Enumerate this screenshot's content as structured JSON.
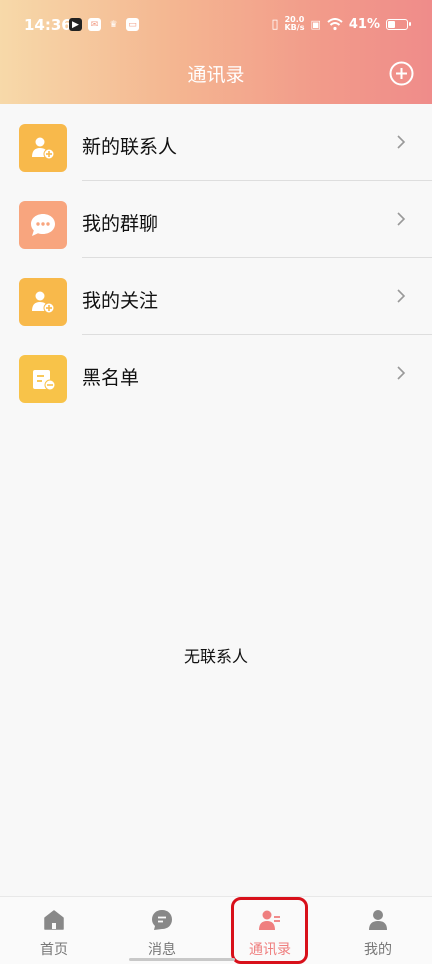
{
  "status_bar": {
    "time": "14:36",
    "net_speed_value": "20.0",
    "net_speed_unit": "KB/s",
    "battery": "41%",
    "battery_level": 0.41
  },
  "header": {
    "title": "通讯录",
    "add_icon": "plus-circle-icon"
  },
  "menu": [
    {
      "label": "新的联系人",
      "icon": "person-add-icon",
      "icon_bg": "#f8b94b"
    },
    {
      "label": "我的群聊",
      "icon": "chat-bubble-icon",
      "icon_bg": "#f8a57e"
    },
    {
      "label": "我的关注",
      "icon": "person-add-icon",
      "icon_bg": "#f8b94b"
    },
    {
      "label": "黑名单",
      "icon": "blacklist-icon",
      "icon_bg": "#f8c349"
    }
  ],
  "empty_text": "无联系人",
  "tabs": [
    {
      "label": "首页",
      "icon": "home-icon",
      "active": false
    },
    {
      "label": "消息",
      "icon": "message-icon",
      "active": false
    },
    {
      "label": "通讯录",
      "icon": "contacts-icon",
      "active": true
    },
    {
      "label": "我的",
      "icon": "profile-icon",
      "active": false
    }
  ],
  "colors": {
    "accent": "#ef7f7f",
    "highlight_border": "#d8101a"
  }
}
